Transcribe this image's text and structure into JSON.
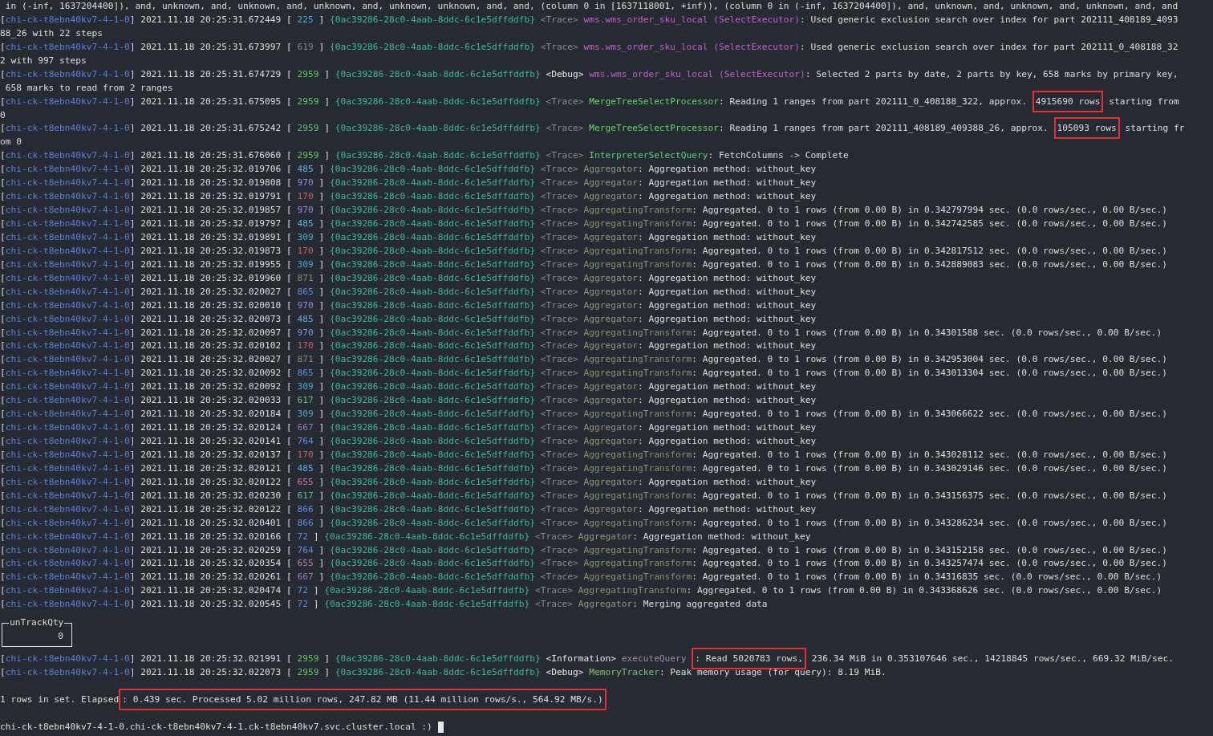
{
  "lines": [
    {
      "kind": "text",
      "text": " in (-inf, 1637204400]), and, unknown, and, unknown, and, unknown, and, unknown, unknown, and, and, (column 0 in [1637118001, +inf)), (column 0 in (-inf, 1637204400]), and, unknown, and, unknown, and, unknown, and, and"
    },
    {
      "kind": "log",
      "open": "[",
      "host": "chi-ck-t8ebn40kv7-4-1-0",
      "time": "] 2021.11.18 20:25:31.672449 [",
      "thread": {
        "text": "225",
        "color": "#4ca9d8"
      },
      "close": "]",
      "query": "{0ac39286-28c0-4aab-8ddc-6c1e5dffddfb}",
      "level": "<Trace>",
      "level_muted": true,
      "component": {
        "text": "wms.wms_order_sku_local (SelectExecutor)",
        "color": "#c062c9"
      },
      "message": ": Used generic exclusion search over index for part 202111_408189_4093"
    },
    {
      "kind": "text",
      "text": "88_26 with 22 steps"
    },
    {
      "kind": "log",
      "open": "[",
      "host": "chi-ck-t8ebn40kv7-4-1-0",
      "time": "] 2021.11.18 20:25:31.673997 [",
      "thread": {
        "text": "619",
        "color": "#7d7f84"
      },
      "close": "]",
      "query": "{0ac39286-28c0-4aab-8ddc-6c1e5dffddfb}",
      "level": "<Trace>",
      "level_muted": true,
      "component": {
        "text": "wms.wms_order_sku_local (SelectExecutor)",
        "color": "#c062c9"
      },
      "message": ": Used generic exclusion search over index for part 202111_0_408188_32"
    },
    {
      "kind": "text",
      "text": "2 with 997 steps"
    },
    {
      "kind": "log",
      "open": "[",
      "host": "chi-ck-t8ebn40kv7-4-1-0",
      "time": "] 2021.11.18 20:25:31.674729 [",
      "thread": {
        "text": "2959",
        "color": "#5ec95e"
      },
      "close": "]",
      "query": "{0ac39286-28c0-4aab-8ddc-6c1e5dffddfb}",
      "level": "<Debug>",
      "level_muted": false,
      "component": {
        "text": "wms.wms_order_sku_local (SelectExecutor)",
        "color": "#c062c9"
      },
      "message": ": Selected 2 parts by date, 2 parts by key, 658 marks by primary key,"
    },
    {
      "kind": "text",
      "text": " 658 marks to read from 2 ranges"
    },
    {
      "kind": "log",
      "open": "[",
      "host": "chi-ck-t8ebn40kv7-4-1-0",
      "time": "] 2021.11.18 20:25:31.675095 [",
      "thread": {
        "text": "2959",
        "color": "#5ec95e"
      },
      "close": "]",
      "query": "{0ac39286-28c0-4aab-8ddc-6c1e5dffddfb}",
      "level": "<Trace>",
      "level_muted": true,
      "component": {
        "text": "MergeTreeSelectProcessor",
        "color": "#62d462"
      },
      "message": ": Reading 1 ranges from part 202111_0_408188_322, approx.",
      "boxed": "4915690 rows",
      "after": "starting from"
    },
    {
      "kind": "text",
      "text": "0"
    },
    {
      "kind": "log",
      "open": "[",
      "host": "chi-ck-t8ebn40kv7-4-1-0",
      "time": "] 2021.11.18 20:25:31.675242 [",
      "thread": {
        "text": "2959",
        "color": "#5ec95e"
      },
      "close": "]",
      "query": "{0ac39286-28c0-4aab-8ddc-6c1e5dffddfb}",
      "level": "<Trace>",
      "level_muted": true,
      "component": {
        "text": "MergeTreeSelectProcessor",
        "color": "#62d462"
      },
      "message": ": Reading 1 ranges from part 202111_408189_409388_26, approx.",
      "boxed": "105093 rows",
      "after": "starting fr"
    },
    {
      "kind": "text",
      "text": "om 0"
    },
    {
      "kind": "log",
      "open": "[",
      "host": "chi-ck-t8ebn40kv7-4-1-0",
      "time": "] 2021.11.18 20:25:31.676060 [",
      "thread": {
        "text": "2959",
        "color": "#5ec95e"
      },
      "close": "]",
      "query": "{0ac39286-28c0-4aab-8ddc-6c1e5dffddfb}",
      "level": "<Trace>",
      "level_muted": true,
      "component": {
        "text": "InterpreterSelectQuery",
        "color": "#5fcf7a"
      },
      "message": ": FetchColumns -> Complete"
    },
    {
      "kind": "log",
      "open": "[",
      "host": "chi-ck-t8ebn40kv7-4-1-0",
      "time": "] 2021.11.18 20:25:32.019706 [",
      "thread": {
        "text": "485",
        "color": "#5fb0e0"
      },
      "close": "]",
      "query": "{0ac39286-28c0-4aab-8ddc-6c1e5dffddfb}",
      "level": "<Trace>",
      "level_muted": true,
      "component": {
        "text": "Aggregator",
        "color": "#8c9c7c"
      },
      "message": ": Aggregation method: without_key"
    },
    {
      "kind": "log",
      "open": "[",
      "host": "chi-ck-t8ebn40kv7-4-1-0",
      "time": "] 2021.11.18 20:25:32.019808 [",
      "thread": {
        "text": "970",
        "color": "#8a8ae0"
      },
      "close": "]",
      "query": "{0ac39286-28c0-4aab-8ddc-6c1e5dffddfb}",
      "level": "<Trace>",
      "level_muted": true,
      "component": {
        "text": "Aggregator",
        "color": "#8c9c7c"
      },
      "message": ": Aggregation method: without_key"
    },
    {
      "kind": "log",
      "open": "[",
      "host": "chi-ck-t8ebn40kv7-4-1-0",
      "time": "] 2021.11.18 20:25:32.019791 [",
      "thread": {
        "text": "170",
        "color": "#c0606a"
      },
      "close": "]",
      "query": "{0ac39286-28c0-4aab-8ddc-6c1e5dffddfb}",
      "level": "<Trace>",
      "level_muted": true,
      "component": {
        "text": "Aggregator",
        "color": "#8c9c7c"
      },
      "message": ": Aggregation method: without_key"
    },
    {
      "kind": "log",
      "open": "[",
      "host": "chi-ck-t8ebn40kv7-4-1-0",
      "time": "] 2021.11.18 20:25:32.019857 [",
      "thread": {
        "text": "970",
        "color": "#8a8ae0"
      },
      "close": "]",
      "query": "{0ac39286-28c0-4aab-8ddc-6c1e5dffddfb}",
      "level": "<Trace>",
      "level_muted": true,
      "component": {
        "text": "AggregatingTransform",
        "color": "#7f9a6a"
      },
      "message": ": Aggregated. 0 to 1 rows (from 0.00 B) in 0.342797994 sec. (0.0 rows/sec., 0.00 B/sec.)"
    },
    {
      "kind": "log",
      "open": "[",
      "host": "chi-ck-t8ebn40kv7-4-1-0",
      "time": "] 2021.11.18 20:25:32.019797 [",
      "thread": {
        "text": "485",
        "color": "#5fb0e0"
      },
      "close": "]",
      "query": "{0ac39286-28c0-4aab-8ddc-6c1e5dffddfb}",
      "level": "<Trace>",
      "level_muted": true,
      "component": {
        "text": "AggregatingTransform",
        "color": "#7f9a6a"
      },
      "message": ": Aggregated. 0 to 1 rows (from 0.00 B) in 0.342742585 sec. (0.0 rows/sec., 0.00 B/sec.)"
    },
    {
      "kind": "log",
      "open": "[",
      "host": "chi-ck-t8ebn40kv7-4-1-0",
      "time": "] 2021.11.18 20:25:32.019891 [",
      "thread": {
        "text": "309",
        "color": "#4fa8c8"
      },
      "close": "]",
      "query": "{0ac39286-28c0-4aab-8ddc-6c1e5dffddfb}",
      "level": "<Trace>",
      "level_muted": true,
      "component": {
        "text": "Aggregator",
        "color": "#8c9c7c"
      },
      "message": ": Aggregation method: without_key"
    },
    {
      "kind": "log",
      "open": "[",
      "host": "chi-ck-t8ebn40kv7-4-1-0",
      "time": "] 2021.11.18 20:25:32.019873 [",
      "thread": {
        "text": "170",
        "color": "#c0606a"
      },
      "close": "]",
      "query": "{0ac39286-28c0-4aab-8ddc-6c1e5dffddfb}",
      "level": "<Trace>",
      "level_muted": true,
      "component": {
        "text": "AggregatingTransform",
        "color": "#7f9a6a"
      },
      "message": ": Aggregated. 0 to 1 rows (from 0.00 B) in 0.342817512 sec. (0.0 rows/sec., 0.00 B/sec.)"
    },
    {
      "kind": "log",
      "open": "[",
      "host": "chi-ck-t8ebn40kv7-4-1-0",
      "time": "] 2021.11.18 20:25:32.019955 [",
      "thread": {
        "text": "309",
        "color": "#4fa8c8"
      },
      "close": "]",
      "query": "{0ac39286-28c0-4aab-8ddc-6c1e5dffddfb}",
      "level": "<Trace>",
      "level_muted": true,
      "component": {
        "text": "AggregatingTransform",
        "color": "#7f9a6a"
      },
      "message": ": Aggregated. 0 to 1 rows (from 0.00 B) in 0.342889083 sec. (0.0 rows/sec., 0.00 B/sec.)"
    },
    {
      "kind": "log",
      "open": "[",
      "host": "chi-ck-t8ebn40kv7-4-1-0",
      "time": "] 2021.11.18 20:25:32.019960 [",
      "thread": {
        "text": "871",
        "color": "#8a8a70"
      },
      "close": "]",
      "query": "{0ac39286-28c0-4aab-8ddc-6c1e5dffddfb}",
      "level": "<Trace>",
      "level_muted": true,
      "component": {
        "text": "Aggregator",
        "color": "#8c9c7c"
      },
      "message": ": Aggregation method: without_key"
    },
    {
      "kind": "log",
      "open": "[",
      "host": "chi-ck-t8ebn40kv7-4-1-0",
      "time": "] 2021.11.18 20:25:32.020027 [",
      "thread": {
        "text": "865",
        "color": "#5f8fe0"
      },
      "close": "]",
      "query": "{0ac39286-28c0-4aab-8ddc-6c1e5dffddfb}",
      "level": "<Trace>",
      "level_muted": true,
      "component": {
        "text": "Aggregator",
        "color": "#8c9c7c"
      },
      "message": ": Aggregation method: without_key"
    },
    {
      "kind": "log",
      "open": "[",
      "host": "chi-ck-t8ebn40kv7-4-1-0",
      "time": "] 2021.11.18 20:25:32.020010 [",
      "thread": {
        "text": "970",
        "color": "#8a8ae0"
      },
      "close": "]",
      "query": "{0ac39286-28c0-4aab-8ddc-6c1e5dffddfb}",
      "level": "<Trace>",
      "level_muted": true,
      "component": {
        "text": "Aggregator",
        "color": "#8c9c7c"
      },
      "message": ": Aggregation method: without_key"
    },
    {
      "kind": "log",
      "open": "[",
      "host": "chi-ck-t8ebn40kv7-4-1-0",
      "time": "] 2021.11.18 20:25:32.020073 [",
      "thread": {
        "text": "485",
        "color": "#5fb0e0"
      },
      "close": "]",
      "query": "{0ac39286-28c0-4aab-8ddc-6c1e5dffddfb}",
      "level": "<Trace>",
      "level_muted": true,
      "component": {
        "text": "Aggregator",
        "color": "#8c9c7c"
      },
      "message": ": Aggregation method: without_key"
    },
    {
      "kind": "log",
      "open": "[",
      "host": "chi-ck-t8ebn40kv7-4-1-0",
      "time": "] 2021.11.18 20:25:32.020097 [",
      "thread": {
        "text": "970",
        "color": "#8a8ae0"
      },
      "close": "]",
      "query": "{0ac39286-28c0-4aab-8ddc-6c1e5dffddfb}",
      "level": "<Trace>",
      "level_muted": true,
      "component": {
        "text": "AggregatingTransform",
        "color": "#7f9a6a"
      },
      "message": ": Aggregated. 0 to 1 rows (from 0.00 B) in 0.34301588 sec. (0.0 rows/sec., 0.00 B/sec.)"
    },
    {
      "kind": "log",
      "open": "[",
      "host": "chi-ck-t8ebn40kv7-4-1-0",
      "time": "] 2021.11.18 20:25:32.020102 [",
      "thread": {
        "text": "170",
        "color": "#c0606a"
      },
      "close": "]",
      "query": "{0ac39286-28c0-4aab-8ddc-6c1e5dffddfb}",
      "level": "<Trace>",
      "level_muted": true,
      "component": {
        "text": "Aggregator",
        "color": "#8c9c7c"
      },
      "message": ": Aggregation method: without_key"
    },
    {
      "kind": "log",
      "open": "[",
      "host": "chi-ck-t8ebn40kv7-4-1-0",
      "time": "] 2021.11.18 20:25:32.020027 [",
      "thread": {
        "text": "871",
        "color": "#8a8a70"
      },
      "close": "]",
      "query": "{0ac39286-28c0-4aab-8ddc-6c1e5dffddfb}",
      "level": "<Trace>",
      "level_muted": true,
      "component": {
        "text": "AggregatingTransform",
        "color": "#7f9a6a"
      },
      "message": ": Aggregated. 0 to 1 rows (from 0.00 B) in 0.342953004 sec. (0.0 rows/sec., 0.00 B/sec.)"
    },
    {
      "kind": "log",
      "open": "[",
      "host": "chi-ck-t8ebn40kv7-4-1-0",
      "time": "] 2021.11.18 20:25:32.020092 [",
      "thread": {
        "text": "865",
        "color": "#5f8fe0"
      },
      "close": "]",
      "query": "{0ac39286-28c0-4aab-8ddc-6c1e5dffddfb}",
      "level": "<Trace>",
      "level_muted": true,
      "component": {
        "text": "AggregatingTransform",
        "color": "#7f9a6a"
      },
      "message": ": Aggregated. 0 to 1 rows (from 0.00 B) in 0.343013304 sec. (0.0 rows/sec., 0.00 B/sec.)"
    },
    {
      "kind": "log",
      "open": "[",
      "host": "chi-ck-t8ebn40kv7-4-1-0",
      "time": "] 2021.11.18 20:25:32.020092 [",
      "thread": {
        "text": "309",
        "color": "#4fa8c8"
      },
      "close": "]",
      "query": "{0ac39286-28c0-4aab-8ddc-6c1e5dffddfb}",
      "level": "<Trace>",
      "level_muted": true,
      "component": {
        "text": "Aggregator",
        "color": "#8c9c7c"
      },
      "message": ": Aggregation method: without_key"
    },
    {
      "kind": "log",
      "open": "[",
      "host": "chi-ck-t8ebn40kv7-4-1-0",
      "time": "] 2021.11.18 20:25:32.020033 [",
      "thread": {
        "text": "617",
        "color": "#5fc080"
      },
      "close": "]",
      "query": "{0ac39286-28c0-4aab-8ddc-6c1e5dffddfb}",
      "level": "<Trace>",
      "level_muted": true,
      "component": {
        "text": "Aggregator",
        "color": "#8c9c7c"
      },
      "message": ": Aggregation method: without_key"
    },
    {
      "kind": "log",
      "open": "[",
      "host": "chi-ck-t8ebn40kv7-4-1-0",
      "time": "] 2021.11.18 20:25:32.020184 [",
      "thread": {
        "text": "309",
        "color": "#4fa8c8"
      },
      "close": "]",
      "query": "{0ac39286-28c0-4aab-8ddc-6c1e5dffddfb}",
      "level": "<Trace>",
      "level_muted": true,
      "component": {
        "text": "AggregatingTransform",
        "color": "#7f9a6a"
      },
      "message": ": Aggregated. 0 to 1 rows (from 0.00 B) in 0.343066622 sec. (0.0 rows/sec., 0.00 B/sec.)"
    },
    {
      "kind": "log",
      "open": "[",
      "host": "chi-ck-t8ebn40kv7-4-1-0",
      "time": "] 2021.11.18 20:25:32.020124 [",
      "thread": {
        "text": "667",
        "color": "#9a7ab8"
      },
      "close": "]",
      "query": "{0ac39286-28c0-4aab-8ddc-6c1e5dffddfb}",
      "level": "<Trace>",
      "level_muted": true,
      "component": {
        "text": "Aggregator",
        "color": "#8c9c7c"
      },
      "message": ": Aggregation method: without_key"
    },
    {
      "kind": "log",
      "open": "[",
      "host": "chi-ck-t8ebn40kv7-4-1-0",
      "time": "] 2021.11.18 20:25:32.020141 [",
      "thread": {
        "text": "764",
        "color": "#5f8fe0"
      },
      "close": "]",
      "query": "{0ac39286-28c0-4aab-8ddc-6c1e5dffddfb}",
      "level": "<Trace>",
      "level_muted": true,
      "component": {
        "text": "Aggregator",
        "color": "#8c9c7c"
      },
      "message": ": Aggregation method: without_key"
    },
    {
      "kind": "log",
      "open": "[",
      "host": "chi-ck-t8ebn40kv7-4-1-0",
      "time": "] 2021.11.18 20:25:32.020137 [",
      "thread": {
        "text": "170",
        "color": "#c0606a"
      },
      "close": "]",
      "query": "{0ac39286-28c0-4aab-8ddc-6c1e5dffddfb}",
      "level": "<Trace>",
      "level_muted": true,
      "component": {
        "text": "AggregatingTransform",
        "color": "#7f9a6a"
      },
      "message": ": Aggregated. 0 to 1 rows (from 0.00 B) in 0.343028112 sec. (0.0 rows/sec., 0.00 B/sec.)"
    },
    {
      "kind": "log",
      "open": "[",
      "host": "chi-ck-t8ebn40kv7-4-1-0",
      "time": "] 2021.11.18 20:25:32.020121 [",
      "thread": {
        "text": "485",
        "color": "#5fb0e0"
      },
      "close": "]",
      "query": "{0ac39286-28c0-4aab-8ddc-6c1e5dffddfb}",
      "level": "<Trace>",
      "level_muted": true,
      "component": {
        "text": "AggregatingTransform",
        "color": "#7f9a6a"
      },
      "message": ": Aggregated. 0 to 1 rows (from 0.00 B) in 0.343029146 sec. (0.0 rows/sec., 0.00 B/sec.)"
    },
    {
      "kind": "log",
      "open": "[",
      "host": "chi-ck-t8ebn40kv7-4-1-0",
      "time": "] 2021.11.18 20:25:32.020122 [",
      "thread": {
        "text": "655",
        "color": "#c07a9a"
      },
      "close": "]",
      "query": "{0ac39286-28c0-4aab-8ddc-6c1e5dffddfb}",
      "level": "<Trace>",
      "level_muted": true,
      "component": {
        "text": "Aggregator",
        "color": "#8c9c7c"
      },
      "message": ": Aggregation method: without_key"
    },
    {
      "kind": "log",
      "open": "[",
      "host": "chi-ck-t8ebn40kv7-4-1-0",
      "time": "] 2021.11.18 20:25:32.020230 [",
      "thread": {
        "text": "617",
        "color": "#5fc080"
      },
      "close": "]",
      "query": "{0ac39286-28c0-4aab-8ddc-6c1e5dffddfb}",
      "level": "<Trace>",
      "level_muted": true,
      "component": {
        "text": "AggregatingTransform",
        "color": "#7f9a6a"
      },
      "message": ": Aggregated. 0 to 1 rows (from 0.00 B) in 0.343156375 sec. (0.0 rows/sec., 0.00 B/sec.)"
    },
    {
      "kind": "log",
      "open": "[",
      "host": "chi-ck-t8ebn40kv7-4-1-0",
      "time": "] 2021.11.18 20:25:32.020122 [",
      "thread": {
        "text": "866",
        "color": "#5f8fe0"
      },
      "close": "]",
      "query": "{0ac39286-28c0-4aab-8ddc-6c1e5dffddfb}",
      "level": "<Trace>",
      "level_muted": true,
      "component": {
        "text": "Aggregator",
        "color": "#8c9c7c"
      },
      "message": ": Aggregation method: without_key"
    },
    {
      "kind": "log",
      "open": "[",
      "host": "chi-ck-t8ebn40kv7-4-1-0",
      "time": "] 2021.11.18 20:25:32.020401 [",
      "thread": {
        "text": "866",
        "color": "#5f8fe0"
      },
      "close": "]",
      "query": "{0ac39286-28c0-4aab-8ddc-6c1e5dffddfb}",
      "level": "<Trace>",
      "level_muted": true,
      "component": {
        "text": "AggregatingTransform",
        "color": "#7f9a6a"
      },
      "message": ": Aggregated. 0 to 1 rows (from 0.00 B) in 0.343286234 sec. (0.0 rows/sec., 0.00 B/sec.)"
    },
    {
      "kind": "log",
      "open": "[",
      "host": "chi-ck-t8ebn40kv7-4-1-0",
      "time": "] 2021.11.18 20:25:32.020166 [",
      "thread": {
        "text": "72",
        "color": "#5f8fe0"
      },
      "close": "]",
      "query": "{0ac39286-28c0-4aab-8ddc-6c1e5dffddfb}",
      "level": "<Trace>",
      "level_muted": true,
      "component": {
        "text": "Aggregator",
        "color": "#8c9c7c"
      },
      "message": ": Aggregation method: without_key"
    },
    {
      "kind": "log",
      "open": "[",
      "host": "chi-ck-t8ebn40kv7-4-1-0",
      "time": "] 2021.11.18 20:25:32.020259 [",
      "thread": {
        "text": "764",
        "color": "#5f8fe0"
      },
      "close": "]",
      "query": "{0ac39286-28c0-4aab-8ddc-6c1e5dffddfb}",
      "level": "<Trace>",
      "level_muted": true,
      "component": {
        "text": "AggregatingTransform",
        "color": "#7f9a6a"
      },
      "message": ": Aggregated. 0 to 1 rows (from 0.00 B) in 0.343152158 sec. (0.0 rows/sec., 0.00 B/sec.)"
    },
    {
      "kind": "log",
      "open": "[",
      "host": "chi-ck-t8ebn40kv7-4-1-0",
      "time": "] 2021.11.18 20:25:32.020354 [",
      "thread": {
        "text": "655",
        "color": "#c07a9a"
      },
      "close": "]",
      "query": "{0ac39286-28c0-4aab-8ddc-6c1e5dffddfb}",
      "level": "<Trace>",
      "level_muted": true,
      "component": {
        "text": "AggregatingTransform",
        "color": "#7f9a6a"
      },
      "message": ": Aggregated. 0 to 1 rows (from 0.00 B) in 0.343257474 sec. (0.0 rows/sec., 0.00 B/sec.)"
    },
    {
      "kind": "log",
      "open": "[",
      "host": "chi-ck-t8ebn40kv7-4-1-0",
      "time": "] 2021.11.18 20:25:32.020261 [",
      "thread": {
        "text": "667",
        "color": "#9a7ab8"
      },
      "close": "]",
      "query": "{0ac39286-28c0-4aab-8ddc-6c1e5dffddfb}",
      "level": "<Trace>",
      "level_muted": true,
      "component": {
        "text": "AggregatingTransform",
        "color": "#7f9a6a"
      },
      "message": ": Aggregated. 0 to 1 rows (from 0.00 B) in 0.34316835 sec. (0.0 rows/sec., 0.00 B/sec.)"
    },
    {
      "kind": "log",
      "open": "[",
      "host": "chi-ck-t8ebn40kv7-4-1-0",
      "time": "] 2021.11.18 20:25:32.020474 [",
      "thread": {
        "text": "72",
        "color": "#5f8fe0"
      },
      "close": "]",
      "query": "{0ac39286-28c0-4aab-8ddc-6c1e5dffddfb}",
      "level": "<Trace>",
      "level_muted": true,
      "component": {
        "text": "AggregatingTransform",
        "color": "#7f9a6a"
      },
      "message": ": Aggregated. 0 to 1 rows (from 0.00 B) in 0.343368626 sec. (0.0 rows/sec., 0.00 B/sec.)"
    },
    {
      "kind": "log",
      "open": "[",
      "host": "chi-ck-t8ebn40kv7-4-1-0",
      "time": "] 2021.11.18 20:25:32.020545 [",
      "thread": {
        "text": "72",
        "color": "#5f8fe0"
      },
      "close": "]",
      "query": "{0ac39286-28c0-4aab-8ddc-6c1e5dffddfb}",
      "level": "<Trace>",
      "level_muted": true,
      "component": {
        "text": "Aggregator",
        "color": "#8c9c7c"
      },
      "message": ": Merging aggregated data"
    },
    {
      "kind": "table",
      "header": "unTrackQty",
      "value": "0"
    },
    {
      "kind": "log",
      "open": "[",
      "host": "chi-ck-t8ebn40kv7-4-1-0",
      "time": "] 2021.11.18 20:25:32.021991 [",
      "thread": {
        "text": "2959",
        "color": "#5ec95e"
      },
      "close": "]",
      "query": "{0ac39286-28c0-4aab-8ddc-6c1e5dffddfb}",
      "level": "<Information>",
      "level_muted": false,
      "component": {
        "text": "executeQuery",
        "color": "#9c8aa8"
      },
      "boxed": ": Read 5020783 rows,",
      "after": "236.34 MiB in 0.353107646 sec., 14218845 rows/sec., 669.32 MiB/sec."
    },
    {
      "kind": "log",
      "open": "[",
      "host": "chi-ck-t8ebn40kv7-4-1-0",
      "time": "] 2021.11.18 20:25:32.022073 [",
      "thread": {
        "text": "2959",
        "color": "#5ec95e"
      },
      "close": "]",
      "query": "{0ac39286-28c0-4aab-8ddc-6c1e5dffddfb}",
      "level": "<Debug>",
      "level_muted": false,
      "component": {
        "text": "MemoryTracker",
        "color": "#7fbf6a"
      },
      "message": ": Peak memory usage (for query): 8.19 MiB."
    },
    {
      "kind": "blank"
    },
    {
      "kind": "text",
      "text": "1 rows in set. Elapsed",
      "boxed": ": 0.439 sec. Processed 5.02 million rows, 247.82 MB (11.44 million rows/s., 564.92 MB/s.)"
    },
    {
      "kind": "blank"
    },
    {
      "kind": "prompt",
      "text": "chi-ck-t8ebn40kv7-4-1-0.chi-ck-t8ebn40kv7-4-1.ck-t8ebn40kv7.svc.cluster.local :)"
    }
  ]
}
